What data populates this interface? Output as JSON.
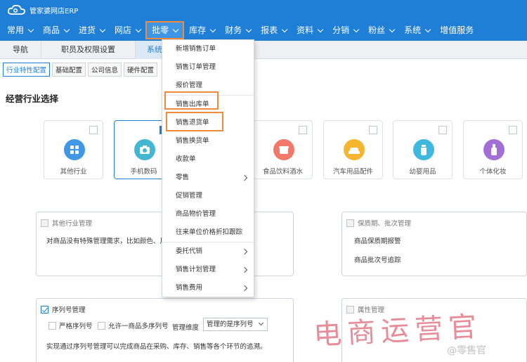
{
  "app": {
    "logo_text": "管家婆网店ERP"
  },
  "nav": [
    {
      "label": "常用"
    },
    {
      "label": "商品"
    },
    {
      "label": "进货"
    },
    {
      "label": "网店"
    },
    {
      "label": "批零"
    },
    {
      "label": "库存"
    },
    {
      "label": "财务"
    },
    {
      "label": "报表"
    },
    {
      "label": "资料"
    },
    {
      "label": "分销"
    },
    {
      "label": "粉丝"
    },
    {
      "label": "系统"
    },
    {
      "label": "增值服务"
    }
  ],
  "tabs": [
    "导航",
    "职员及权限设置",
    "系统配"
  ],
  "subtabs": [
    "行业特性配置",
    "基础配置",
    "公司信息",
    "硬件配置"
  ],
  "section_title": "经营行业选择",
  "industries": [
    {
      "label": "其他行业",
      "color": "#3f97e5"
    },
    {
      "label": "手机数码",
      "color": "#43b7d2"
    },
    {
      "label": "食品饮料酒水",
      "color": "#f2796a"
    },
    {
      "label": "汽车用品配件",
      "color": "#f6b52e"
    },
    {
      "label": "幼婴用品",
      "color": "#3fb8e0"
    },
    {
      "label": "个体化妆",
      "color": "#a16fd6"
    }
  ],
  "panels": {
    "other": {
      "title": "其他行业管理",
      "desc": "对商品没有特殊管理需求，比如颜色、尺"
    },
    "expiry": {
      "title": "保质期、批次管理",
      "line1": "商品保质期报警",
      "line2": "商品批次号追踪"
    },
    "serial": {
      "title": "序列号管理",
      "opt1": "严格序列号",
      "opt2": "允许一商品多序列号",
      "dim_label": "管理维度",
      "dim_value": "管理的是序列号",
      "desc": "实现通过序列号管理可以完成商品在采购、库存、销售等各个环节的追溯。"
    },
    "attr": {
      "title": "属性管理"
    }
  },
  "dropdown": [
    {
      "label": "新增销售订单"
    },
    {
      "label": "销售订单管理"
    },
    {
      "label": "报价管理"
    },
    {
      "label": "销售出库单"
    },
    {
      "label": "销售退货单"
    },
    {
      "label": "销售换货单"
    },
    {
      "label": "收款单"
    },
    {
      "label": "零售"
    },
    {
      "label": "促销管理"
    },
    {
      "label": "商品物价管理"
    },
    {
      "label": "往来单位价格折扣跟踪"
    },
    {
      "label": "委托代销"
    },
    {
      "label": "销售计划管理"
    },
    {
      "label": "销售费用"
    }
  ],
  "watermark": {
    "text": "电商运营官",
    "sub": "@零售官"
  }
}
